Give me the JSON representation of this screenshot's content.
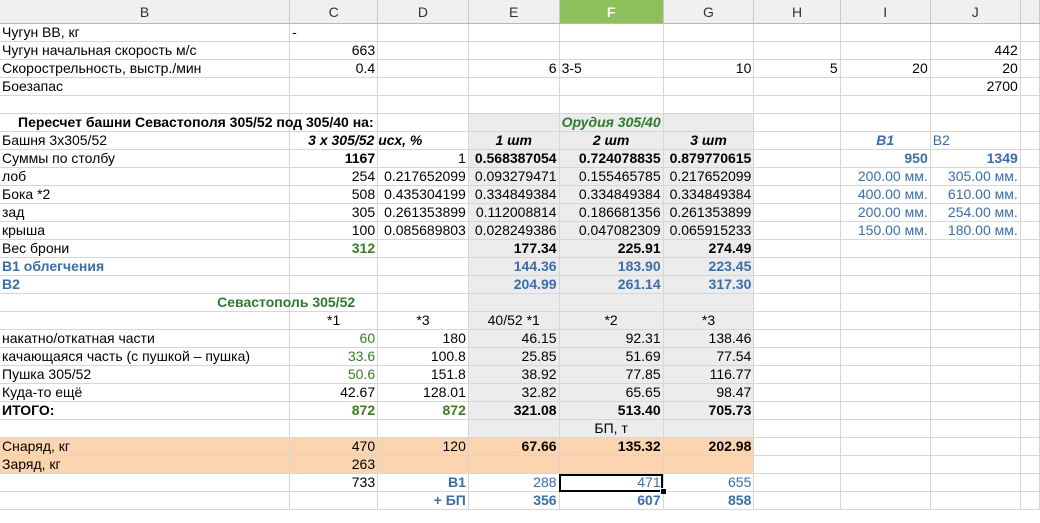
{
  "columns": [
    "B",
    "C",
    "D",
    "E",
    "F",
    "G",
    "H",
    "I",
    "J"
  ],
  "selected_column": "F",
  "rows": {
    "r1": {
      "B": "Чугун ВВ, кг",
      "C": "-"
    },
    "r2": {
      "B": "Чугун начальная скорость м/с",
      "C": "663",
      "J": "442"
    },
    "r3": {
      "B": "Скорострельность, выстр./мин",
      "C": "0.4",
      "E": "6",
      "F": "3-5",
      "G": "10",
      "H": "5",
      "I": "20",
      "J": "20"
    },
    "r4": {
      "B": "Боезапас",
      "J": "2700"
    },
    "r6": {
      "B": "Пересчет башни Севастополя 305/52 под 305/40 на:",
      "F": "Орудия 305/40"
    },
    "r7": {
      "B": "Башня 3х305/52",
      "C": "3 х 305/52 исх, %",
      "E": "1 шт",
      "F": "2 шт",
      "G": "3 шт",
      "I": "B1",
      "J": "B2"
    },
    "r8": {
      "B": "Суммы по столбу",
      "C": "1167",
      "D": "1",
      "E": "0.568387054",
      "F": "0.724078835",
      "G": "0.879770615",
      "I": "950",
      "J": "1349"
    },
    "r9": {
      "B": "лоб",
      "C": "254",
      "D": "0.217652099",
      "E": "0.093279471",
      "F": "0.155465785",
      "G": "0.217652099",
      "I": "200.00 мм.",
      "J": "305.00 мм."
    },
    "r10": {
      "B": "Бока *2",
      "C": "508",
      "D": "0.435304199",
      "E": "0.334849384",
      "F": "0.334849384",
      "G": "0.334849384",
      "I": "400.00 мм.",
      "J": "610.00 мм."
    },
    "r11": {
      "B": "зад",
      "C": "305",
      "D": "0.261353899",
      "E": "0.112008814",
      "F": "0.186681356",
      "G": "0.261353899",
      "I": "200.00 мм.",
      "J": "254.00 мм."
    },
    "r12": {
      "B": "крыша",
      "C": "100",
      "D": "0.085689803",
      "E": "0.028249386",
      "F": "0.047082309",
      "G": "0.065915233",
      "I": "150.00 мм.",
      "J": "180.00 мм."
    },
    "r13": {
      "B": "Вес брони",
      "C": "312",
      "E": "177.34",
      "F": "225.91",
      "G": "274.49"
    },
    "r14": {
      "B": "B1 облегчения",
      "E": "144.36",
      "F": "183.90",
      "G": "223.45"
    },
    "r15": {
      "B": "B2",
      "E": "204.99",
      "F": "261.14",
      "G": "317.30"
    },
    "r16": {
      "C": "Севастополь 305/52"
    },
    "r17": {
      "C": "*1",
      "D": "*3",
      "E": "40/52 *1",
      "F": "*2",
      "G": "*3"
    },
    "r18": {
      "B": "накатно/откатная части",
      "C": "60",
      "D": "180",
      "E": "46.15",
      "F": "92.31",
      "G": "138.46"
    },
    "r19": {
      "B": "качающаяся часть (с пушкой – пушка)",
      "C": "33.6",
      "D": "100.8",
      "E": "25.85",
      "F": "51.69",
      "G": "77.54"
    },
    "r20": {
      "B": "Пушка 305/52",
      "C": "50.6",
      "D": "151.8",
      "E": "38.92",
      "F": "77.85",
      "G": "116.77"
    },
    "r21": {
      "B": "Куда-то ещё",
      "C": "42.67",
      "D": "128.01",
      "E": "32.82",
      "F": "65.65",
      "G": "98.47"
    },
    "r22": {
      "B": "ИТОГО:",
      "C": "872",
      "D": "872",
      "E": "321.08",
      "F": "513.40",
      "G": "705.73"
    },
    "r23": {
      "F": "БП, т"
    },
    "r24": {
      "B": "Снаряд, кг",
      "C": "470",
      "D": "120",
      "E": "67.66",
      "F": "135.32",
      "G": "202.98"
    },
    "r25": {
      "B": "Заряд, кг",
      "C": "263"
    },
    "r26": {
      "C": "733",
      "D": "B1",
      "E": "288",
      "F": "471",
      "G": "655"
    },
    "r27": {
      "D": "+ БП",
      "E": "356",
      "F": "607",
      "G": "858"
    }
  }
}
